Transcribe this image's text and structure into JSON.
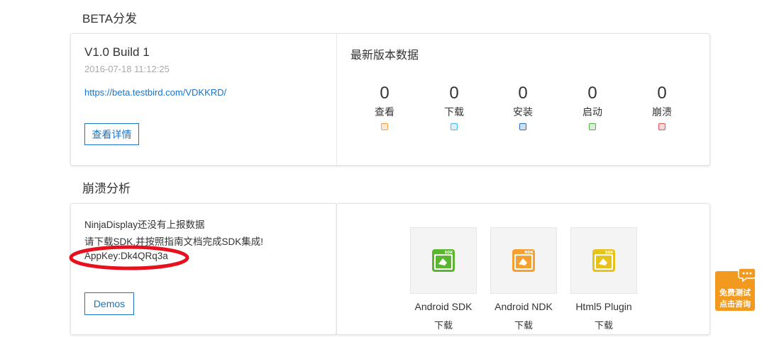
{
  "beta": {
    "section_title": "BETA分发",
    "version": "V1.0 Build 1",
    "timestamp": "2016-07-18 11:12:25",
    "link": "https://beta.testbird.com/VDKKRD/",
    "details_button": "查看详情",
    "stats_title": "最新版本数据",
    "stats": [
      {
        "value": "0",
        "label": "查看",
        "color": "#f5a04a",
        "fill": "#fde9cf"
      },
      {
        "value": "0",
        "label": "下载",
        "color": "#4fb8e8",
        "fill": "#d7f0fb"
      },
      {
        "value": "0",
        "label": "安装",
        "color": "#2a6fb8",
        "fill": "#cfe0f2"
      },
      {
        "value": "0",
        "label": "启动",
        "color": "#4cb34c",
        "fill": "#d8f0d8"
      },
      {
        "value": "0",
        "label": "崩溃",
        "color": "#e0505a",
        "fill": "#f9d8da"
      }
    ]
  },
  "crash": {
    "section_title": "崩溃分析",
    "message_line1": "NinjaDisplay还没有上报数据",
    "message_line2": "请下载SDK,并按照指南文档完成SDK集成!",
    "appkey": "AppKey:Dk4QRq3a",
    "demos_button": "Demos",
    "sdks": [
      {
        "name": "Android SDK",
        "download": "下载",
        "badge": "SDK",
        "color": "#5cb531",
        "icon": "android-sdk-icon"
      },
      {
        "name": "Android NDK",
        "download": "下载",
        "badge": "NDK",
        "color": "#f5a030",
        "icon": "android-ndk-icon"
      },
      {
        "name": "Html5 Plugin",
        "download": "下载",
        "badge": "SDK",
        "color": "#e8c21c",
        "icon": "html5-plugin-icon"
      }
    ]
  },
  "float": {
    "line1": "免费测试",
    "line2": "点击咨询"
  }
}
